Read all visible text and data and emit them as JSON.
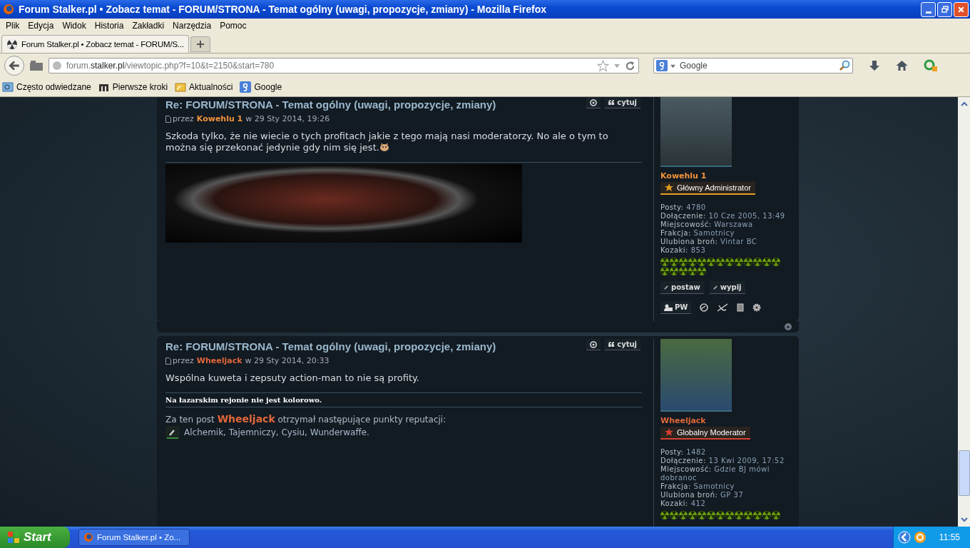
{
  "window": {
    "title": "Forum Stalker.pl • Zobacz temat - FORUM/STRONA - Temat ogólny (uwagi, propozycje, zmiany) - Mozilla Firefox"
  },
  "menu": [
    "Plik",
    "Edycja",
    "Widok",
    "Historia",
    "Zakładki",
    "Narzędzia",
    "Pomoc"
  ],
  "tabs": [
    {
      "label": "Forum Stalker.pl • Zobacz temat - FORUM/S...",
      "selected": true
    }
  ],
  "address_bar": {
    "url_start": "forum.",
    "url_host": "stalker.pl",
    "url_rest": "/viewtopic.php?f=10&t=2150&start=780"
  },
  "search": {
    "placeholder": "Google"
  },
  "bookmarks": [
    {
      "kind": "folder",
      "label": "Często odwiedzane"
    },
    {
      "kind": "m",
      "label": "Pierwsze kroki"
    },
    {
      "kind": "feed",
      "label": "Aktualności"
    },
    {
      "kind": "google",
      "label": "Google"
    }
  ],
  "posts": [
    {
      "title": "Re: FORUM/STRONA - Temat ogólny (uwagi, propozycje, zmiany)",
      "by": "przez",
      "author": "Kowehlu 1",
      "date": "w 29 Sty 2014, 19:26",
      "quote": "cytuj",
      "body": "Szkoda tylko, że nie wiecie o tych profitach jakie z tego mają nasi moderatorzy. No ale o tym to można się przekonać jedynie gdy nim się jest.",
      "signature": {
        "kind": "image"
      },
      "profile": {
        "name": "Kowehlu 1",
        "color": "#f0923a",
        "rank": {
          "label": "Główny Administrator",
          "color": "#e0a020"
        },
        "stats": [
          {
            "label": "Posty:",
            "value": "4780"
          },
          {
            "label": "Dołączenie:",
            "value": "10 Cze 2005, 13:49"
          },
          {
            "label": "Miejscowość:",
            "value": "Warszawa"
          },
          {
            "label": "Frakcja:",
            "value": "Samotnicy"
          },
          {
            "label": "Ulubiona broń:",
            "value": "Vintar BC"
          },
          {
            "label": "Kozaki:",
            "value": "853"
          }
        ],
        "actions": [
          "postaw",
          "wypij"
        ],
        "pm": "PW"
      }
    },
    {
      "title": "Re: FORUM/STRONA - Temat ogólny (uwagi, propozycje, zmiany)",
      "by": "przez",
      "author": "Wheeljack",
      "date": "w 29 Sty 2014, 20:33",
      "quote": "cytuj",
      "body": "Wspólna kuweta i zepsuty action-man to nie są profity.",
      "signature": {
        "kind": "text",
        "text": "Na łazarskim rejonie nie jest kolorowo."
      },
      "reputation": {
        "text": "Za ten post **Wheeljack** otrzymał następujące punkty reputacji:",
        "users": "Alchemik, Tajemniczy, Cysiu, Wunderwaffe."
      },
      "profile": {
        "name": "Wheeljack",
        "color": "#e0683a",
        "rank": {
          "label": "Globalny Moderator",
          "color": "#d84030"
        },
        "stats": [
          {
            "label": "Posty:",
            "value": "1482"
          },
          {
            "label": "Dołączenie:",
            "value": "13 Kwi 2009, 17:52"
          },
          {
            "label": "Miejscowość:",
            "value": "Gdzie BJ mówi dobranoc"
          },
          {
            "label": "Frakcja:",
            "value": "Samotnicy"
          },
          {
            "label": "Ulubiona broń:",
            "value": "GP 37"
          },
          {
            "label": "Kozaki:",
            "value": "412"
          }
        ]
      }
    }
  ],
  "taskbar": {
    "start": "Start",
    "tasks": [
      {
        "label": "Forum Stalker.pl • Zo...",
        "selected": false
      }
    ],
    "clock": "11:55"
  }
}
